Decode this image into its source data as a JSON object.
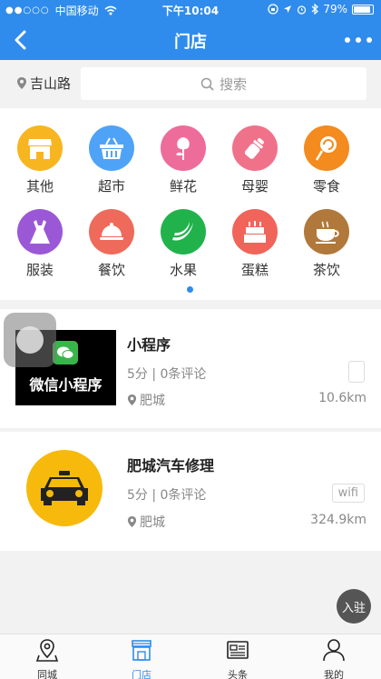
{
  "status_bar": {
    "signal_dots": "●●○○○",
    "carrier": "中国移动",
    "time": "下午10:04",
    "battery": "79%"
  },
  "nav": {
    "title": "门店"
  },
  "search": {
    "location": "吉山路",
    "placeholder": "搜索"
  },
  "categories": [
    {
      "label": "其他",
      "color": "#f7b520",
      "icon": "shop-icon"
    },
    {
      "label": "超市",
      "color": "#4fa3f7",
      "icon": "basket-icon"
    },
    {
      "label": "鲜花",
      "color": "#ee6c9a",
      "icon": "flower-icon"
    },
    {
      "label": "母婴",
      "color": "#f0728a",
      "icon": "baby-bottle-icon"
    },
    {
      "label": "零食",
      "color": "#f48b1f",
      "icon": "lollipop-icon"
    },
    {
      "label": "服装",
      "color": "#9b58d6",
      "icon": "dress-icon"
    },
    {
      "label": "餐饮",
      "color": "#ee6a5a",
      "icon": "dish-cover-icon"
    },
    {
      "label": "水果",
      "color": "#22b24c",
      "icon": "banana-icon"
    },
    {
      "label": "蛋糕",
      "color": "#f0645a",
      "icon": "cake-icon"
    },
    {
      "label": "茶饮",
      "color": "#b0783a",
      "icon": "tea-cup-icon"
    }
  ],
  "stores": [
    {
      "name": "小程序",
      "thumb_text": "微信小程序",
      "rating": "5分 | 0条评论",
      "location": "肥城",
      "distance": "10.6km",
      "tag": ""
    },
    {
      "name": "肥城汽车修理",
      "rating": "5分 | 0条评论",
      "location": "肥城",
      "distance": "324.9km",
      "tag": "wifi"
    }
  ],
  "float_button": {
    "label": "入驻"
  },
  "tabs": [
    {
      "label": "同城",
      "active": false
    },
    {
      "label": "门店",
      "active": true
    },
    {
      "label": "头条",
      "active": false
    },
    {
      "label": "我的",
      "active": false
    }
  ],
  "colors": {
    "primary": "#2f8cec",
    "background": "#f2f2f2"
  }
}
